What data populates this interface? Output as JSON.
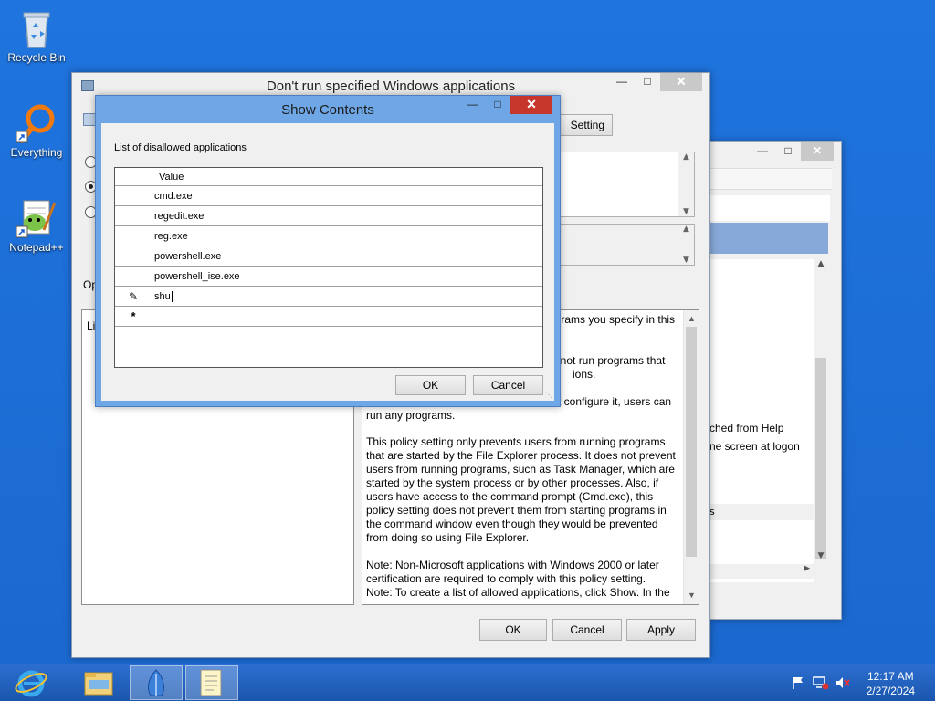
{
  "desktop": {
    "icons": [
      {
        "label": "Recycle Bin"
      },
      {
        "label": "Everything"
      },
      {
        "label": "Notepad++"
      }
    ]
  },
  "policy_window": {
    "title": "Don't run specified Windows applications",
    "setting_btn_fragment": "Setting",
    "options_fragment": "Op",
    "list_fragment": "Li",
    "help_text": [
      "This policy setting prevents Windows from running the programs you specify in this policy setting.",
      "If you enable this policy setting, users cannot run programs that you add to the list of disallowed applications.",
      "If you disable this policy setting or do not configure it, users can run any programs.",
      "This policy setting only prevents users from running programs that are started by the File Explorer process. It does not prevent users from running programs, such as Task Manager, which are started by the system process or by other processes.  Also, if users have access to the command prompt (Cmd.exe), this policy setting does not prevent them from starting programs in the command window even though they would be prevented from doing so using File Explorer.",
      "Note: Non-Microsoft applications with Windows 2000 or later certification are required to comply with this policy setting.",
      "Note: To create a list of allowed applications, click Show.  In the"
    ],
    "help_visible_fragments": {
      "l1": "ograms you specify in this",
      "l2": "nnot run programs that",
      "l3": "ions.",
      "l4": "t configure it, users can",
      "l5": "run any programs."
    },
    "buttons": {
      "ok": "OK",
      "cancel": "Cancel",
      "apply": "Apply"
    }
  },
  "background_window": {
    "text_fragments": [
      "ched from Help",
      "ne screen at logon",
      "s"
    ]
  },
  "show_contents": {
    "title": "Show Contents",
    "list_label": "List of disallowed applications",
    "column_header": "Value",
    "rows": [
      "cmd.exe",
      "regedit.exe",
      "reg.exe",
      "powershell.exe",
      "powershell_ise.exe"
    ],
    "editing_value": "shu",
    "buttons": {
      "ok": "OK",
      "cancel": "Cancel"
    }
  },
  "taskbar": {
    "time": "12:17 AM",
    "date": "2/27/2024"
  },
  "colors": {
    "desktop": "#1f74de",
    "taskbar": "#1a56ad",
    "dialog_frame": "#6fa7e6",
    "close_red": "#c7362b"
  }
}
